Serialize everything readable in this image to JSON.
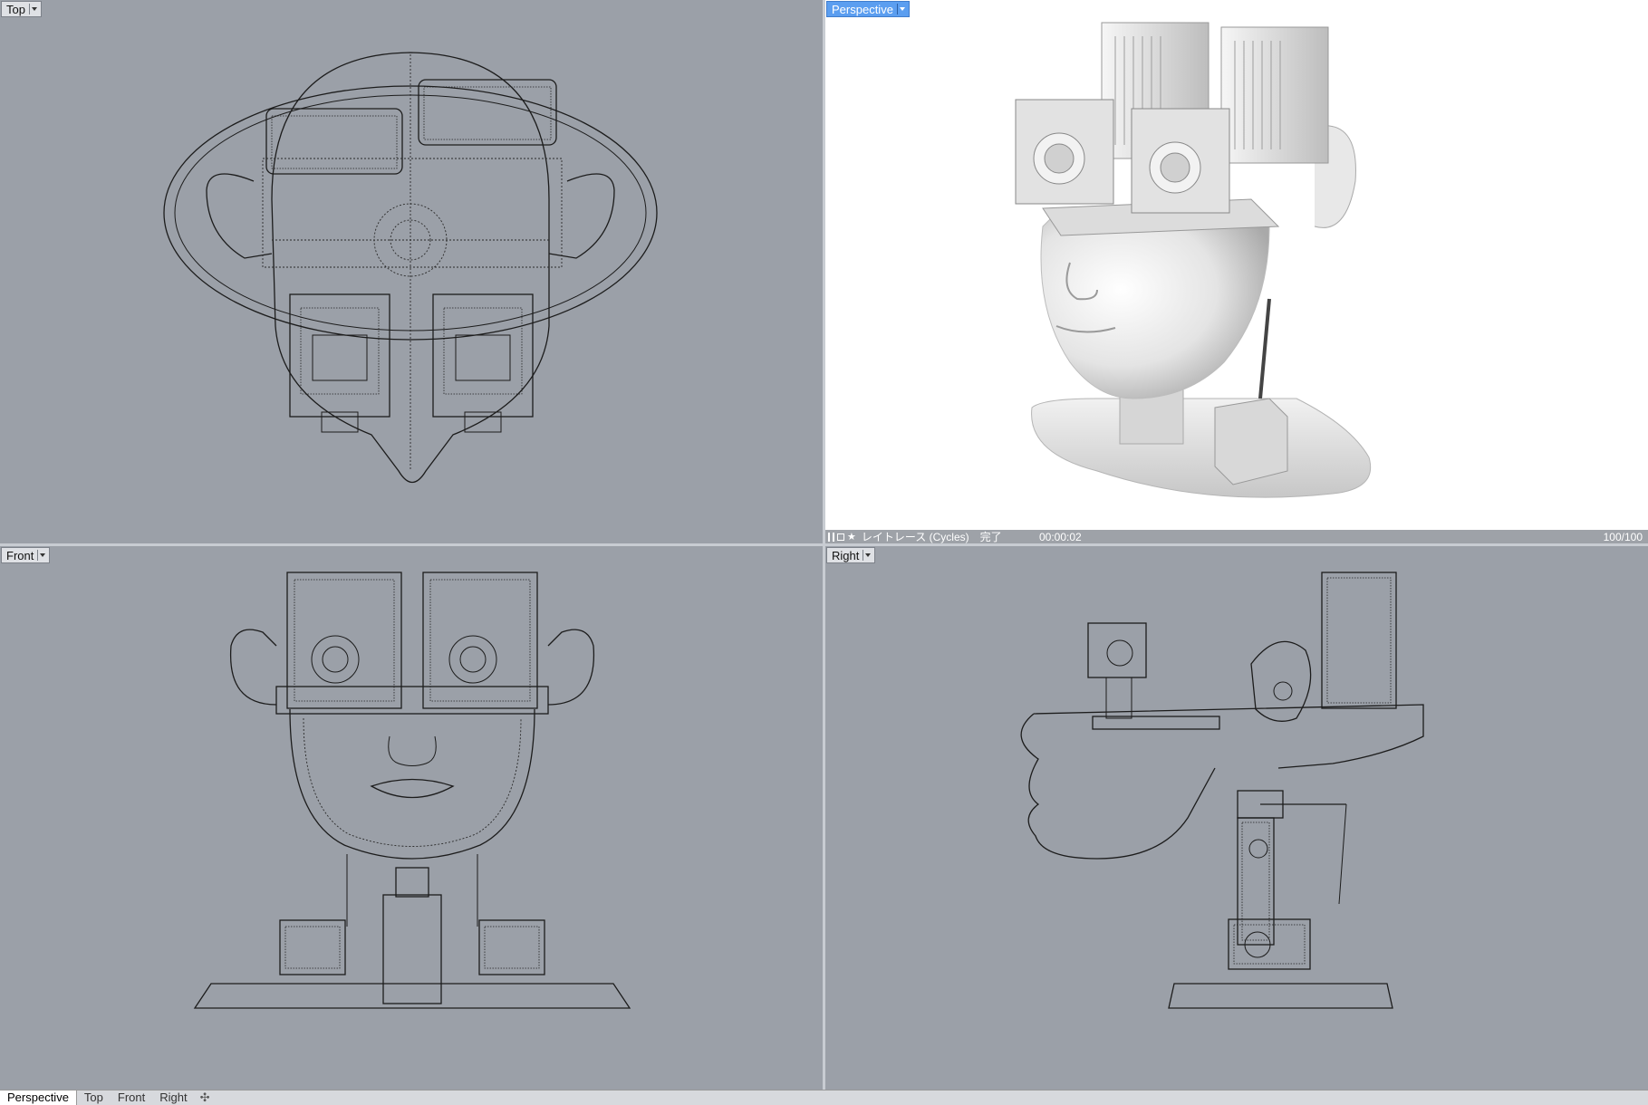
{
  "viewports": {
    "top": {
      "label": "Top"
    },
    "perspective": {
      "label": "Perspective"
    },
    "front": {
      "label": "Front"
    },
    "right": {
      "label": "Right"
    }
  },
  "render_status": {
    "message": "レイトレース (Cycles)　完了",
    "time": "00:00:02",
    "progress": "100/100"
  },
  "tabs": [
    {
      "label": "Perspective",
      "active": true
    },
    {
      "label": "Top",
      "active": false
    },
    {
      "label": "Front",
      "active": false
    },
    {
      "label": "Right",
      "active": false
    }
  ],
  "icons": {
    "viewport_menu": "chevron-down-icon",
    "add_tab": "plus-icon",
    "render_pause": "pause-icon",
    "render_lock": "lock-icon",
    "render_star": "star-icon"
  },
  "colors": {
    "viewport_bg": "#9ba0a8",
    "render_bg": "#ffffff",
    "active_label": "#5b9ef0",
    "wire": "#1c1c1c"
  }
}
